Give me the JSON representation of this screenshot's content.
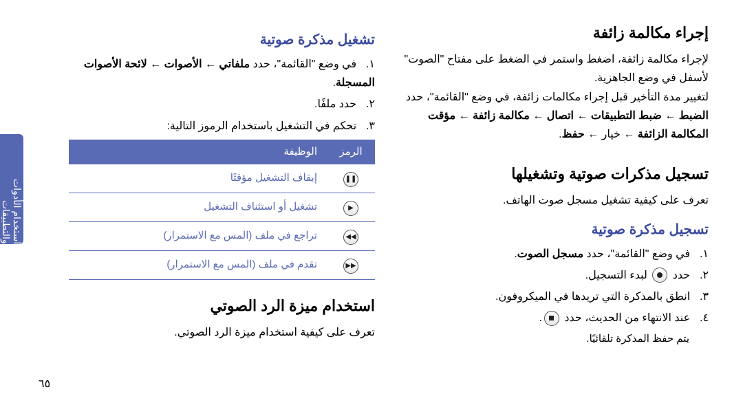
{
  "sidebar_label": "استخدام الأدوات والتطبيقات",
  "page_number": "٦٥",
  "right": {
    "h_fake_call": "إجراء مكالمة زائفة",
    "fake_call_p1": "لإجراء مكالمة زائفة، اضغط واستمر في الضغط على مفتاح \"الصوت\" لأسفل في وضع الجاهزية.",
    "fake_call_p2_a": "لتغيير مدة التأخير قبل إجراء مكالمات زائفة، في وضع \"القائمة\"، حدد ",
    "fake_call_p2_b": "الضبط ← ضبط التطبيقات ← اتصال ← مكالمة زائفة ← مؤقت المكالمة الزائفة ← ",
    "fake_call_p2_c": "خيار ← ",
    "fake_call_p2_d": "حفظ",
    "h_voice_memos": "تسجيل مذكرات صوتية وتشغيلها",
    "voice_memos_intro": "تعرف على كيفية تشغيل مسجل صوت الهاتف.",
    "h_record_memo": "تسجيل مذكرة صوتية",
    "rec_1_a": "في وضع \"القائمة\"، حدد ",
    "rec_1_b": "مسجل الصوت",
    "rec_2_a": "حدد ",
    "rec_2_b": " لبدء التسجيل.",
    "rec_3": "انطق بالمذكرة التي تريدها في الميكروفون.",
    "rec_4_a": "عند الانتهاء من الحديث، حدد ",
    "rec_4_note": "يتم حفظ المذكرة تلقائيًا.",
    "num1": "١.",
    "num2": "٢.",
    "num3": "٣.",
    "num4": "٤."
  },
  "left": {
    "h_play_memo": "تشغيل مذكرة صوتية",
    "play_1_a": "في وضع \"القائمة\"، حدد ",
    "play_1_b": "ملفاتي ← الأصوات ← لائحة الأصوات المسجلة",
    "play_2": "حدد ملفًا.",
    "play_3": "تحكم في التشغيل باستخدام الرموز التالية:",
    "th_icon": "الرمز",
    "th_func": "الوظيفة",
    "row1": "إيقاف التشغيل مؤقتًا",
    "row2": "تشغيل أو استئناف التشغيل",
    "row3": "تراجع في ملف (المس مع الاستمرار)",
    "row4": "تقدم في ملف (المس مع الاستمرار)",
    "h_voicemail": "استخدام ميزة الرد الصوتي",
    "voicemail_intro": "تعرف على كيفية استخدام ميزة الرد الصوتي.",
    "num1": "١.",
    "num2": "٢.",
    "num3": "٣."
  }
}
